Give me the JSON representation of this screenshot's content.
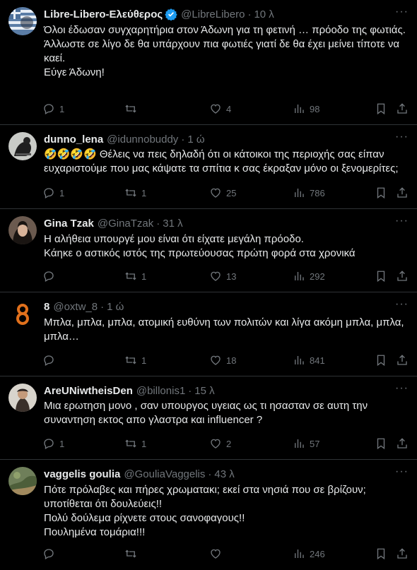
{
  "tweets": [
    {
      "name": "Libre-Libero-Ελεύθερος",
      "handle": "@LibreLibero",
      "dot": "·",
      "time": "10 λ",
      "verified": true,
      "lines": [
        "Όλοι έδωσαν συγχαρητήρια στον Άδωνη για τη φετινή … πρόοδο της φωτιάς.",
        "Άλλωστε σε λίγο δε θα υπάρχουν πια φωτιές γιατί δε θα έχει μείνει τίποτε να καεί.",
        "Εύγε Άδωνη!"
      ],
      "replies": "1",
      "retweets": "",
      "likes": "4",
      "views": "98"
    },
    {
      "name": "dunno_lena",
      "handle": "@idunnobuddy",
      "dot": "·",
      "time": "1 ώ",
      "emoji": "🤣🤣🤣🤣",
      "lines": [
        "Θέλεις να πεις δηλαδή ότι οι κάτοικοι της περιοχής σας είπαν ευχαριστούμε που μας κάψατε τα σπίτια κ σας έκραξαν μόνο οι ξενομερίτες;"
      ],
      "replies": "1",
      "retweets": "1",
      "likes": "25",
      "views": "786"
    },
    {
      "name": "Gina Tzak",
      "handle": "@GinaTzak",
      "dot": "·",
      "time": "31 λ",
      "lines": [
        "Η αλήθεια υπουργέ μου είναι ότι είχατε μεγάλη πρόοδο.",
        "Κάηκε ο αστικός ιστός της πρωτεύουσας πρώτη φορά στα χρονικά"
      ],
      "replies": "",
      "retweets": "1",
      "likes": "13",
      "views": "292"
    },
    {
      "name": "8",
      "handle": "@oxtw_8",
      "dot": "·",
      "time": "1 ώ",
      "lines": [
        "Μπλα, μπλα, μπλα, ατομική ευθύνη των πολιτών και λίγα ακόμη μπλα, μπλα, μπλα…"
      ],
      "replies": "",
      "retweets": "1",
      "likes": "18",
      "views": "841"
    },
    {
      "name": "AreUNiwtheisDen",
      "handle": "@billonis1",
      "dot": "·",
      "time": "15 λ",
      "lines": [
        "Μια ερωτηση μονο , σαν υπουργος υγειας ως τι ησασταν σε αυτη την συναντηση εκτος απο γλαστρα και influencer ?"
      ],
      "replies": "1",
      "retweets": "1",
      "likes": "2",
      "views": "57"
    },
    {
      "name": "vaggelis goulia",
      "handle": "@GouliaVaggelis",
      "dot": "·",
      "time": "43 λ",
      "lines": [
        "Πότε πρόλαβες και πήρες χρωματακι; εκεί στα νησιά που σε βρίζουν;",
        "υποτίθεται ότι δουλεύεις!!",
        "Πολύ δούλεμα ρίχνετε στους σανοφαγους!!",
        "Πουλημένα τομάρια!!!"
      ],
      "replies": "",
      "retweets": "",
      "likes": "",
      "views": "246"
    }
  ],
  "icons": {
    "reply": "reply-icon",
    "retweet": "retweet-icon",
    "like": "heart-icon",
    "views": "views-icon",
    "bookmark": "bookmark-icon",
    "share": "share-icon",
    "more": "more-icon",
    "verified": "verified-badge-icon"
  },
  "colors": {
    "background": "#000000",
    "text": "#e7e9ea",
    "secondary": "#71767b",
    "divider": "#2f3336",
    "verified": "#1d9bf0"
  }
}
